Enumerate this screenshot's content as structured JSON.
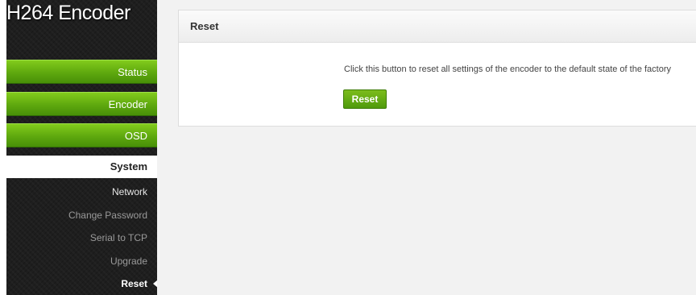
{
  "app": {
    "title": "H264 Encoder"
  },
  "sidebar": {
    "menu": [
      {
        "label": "Status"
      },
      {
        "label": "Encoder"
      },
      {
        "label": "OSD"
      }
    ],
    "active_section": "System",
    "submenu": [
      {
        "label": "Network"
      },
      {
        "label": "Change Password"
      },
      {
        "label": "Serial to TCP"
      },
      {
        "label": "Upgrade"
      },
      {
        "label": "Reset"
      }
    ]
  },
  "panel": {
    "title": "Reset",
    "description": "Click this button to reset all settings of the encoder to the default state of the factory",
    "button_label": "Reset"
  },
  "colors": {
    "accent_green": "#5ea80e",
    "sidebar_bg": "#1e1e1e",
    "main_bg": "#f2f2f2"
  }
}
